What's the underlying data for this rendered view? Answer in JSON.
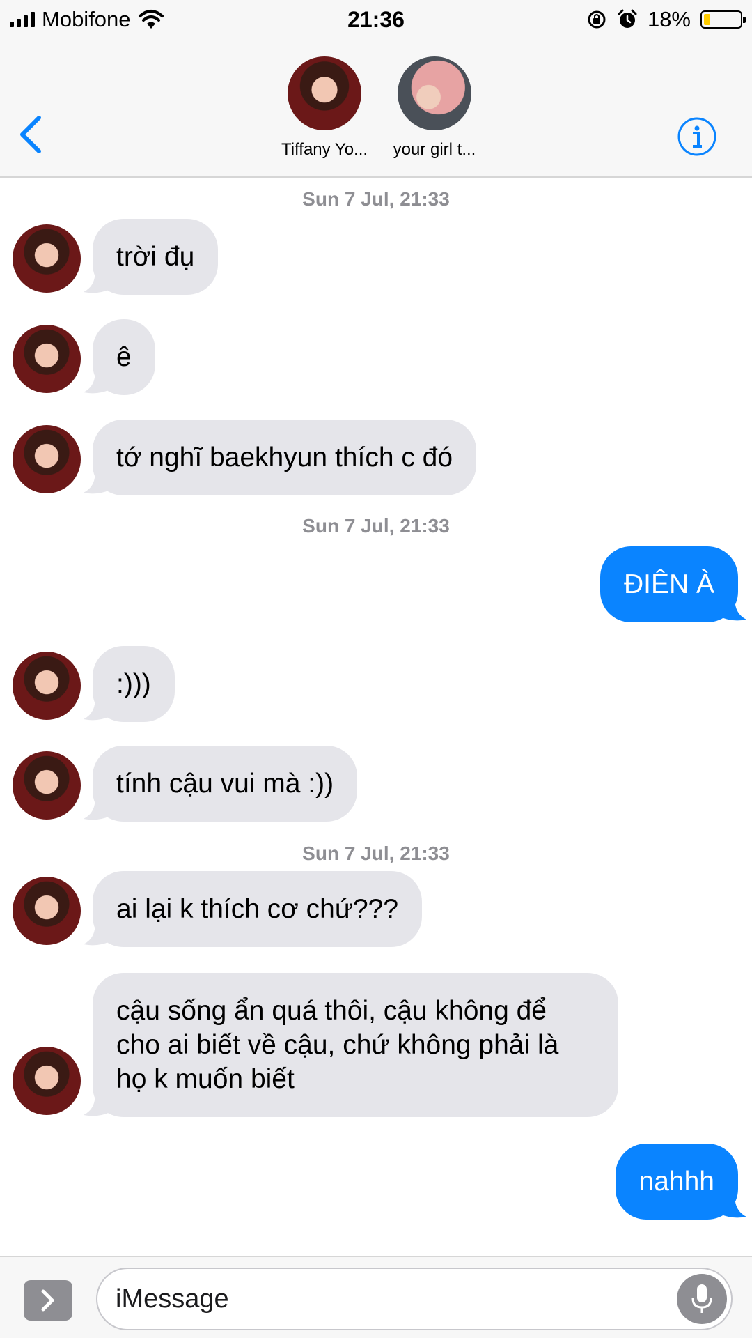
{
  "status_bar": {
    "carrier": "Mobifone",
    "time": "21:36",
    "battery_percent": "18%",
    "battery_level": 0.18,
    "icons": [
      "signal-icon",
      "wifi-icon",
      "rotation-lock-icon",
      "alarm-icon",
      "battery-icon"
    ]
  },
  "header": {
    "back_icon": "chevron-left-icon",
    "info_icon": "info-icon",
    "participants": [
      {
        "name": "Tiffany Yo..."
      },
      {
        "name": "your girl t..."
      }
    ]
  },
  "conversation": {
    "timestamps": [
      "Sun 7 Jul, 21:33",
      "Sun 7 Jul, 21:33",
      "Sun 7 Jul, 21:33"
    ],
    "messages": [
      {
        "dir": "in",
        "text": "trời đụ"
      },
      {
        "dir": "in",
        "text": "ê"
      },
      {
        "dir": "in",
        "text": "tớ nghĩ baekhyun thích c đó"
      },
      {
        "dir": "out",
        "text": "ĐIÊN À"
      },
      {
        "dir": "in",
        "text": ":)))"
      },
      {
        "dir": "in",
        "text": "tính cậu vui mà :))"
      },
      {
        "dir": "in",
        "text": "ai lại k thích cơ chứ???"
      },
      {
        "dir": "in",
        "text": "cậu sống ẩn quá thôi, cậu không để cho ai biết về cậu, chứ không phải là họ k muốn biết"
      },
      {
        "dir": "out",
        "text": "nahhh"
      }
    ]
  },
  "input_bar": {
    "placeholder": "iMessage",
    "value": "",
    "apps_icon": "chevron-right-icon",
    "mic_icon": "microphone-icon"
  },
  "colors": {
    "outgoing_bubble": "#0a84ff",
    "incoming_bubble": "#e5e5ea",
    "accent": "#0a84ff",
    "timestamp": "#8e8e93"
  }
}
